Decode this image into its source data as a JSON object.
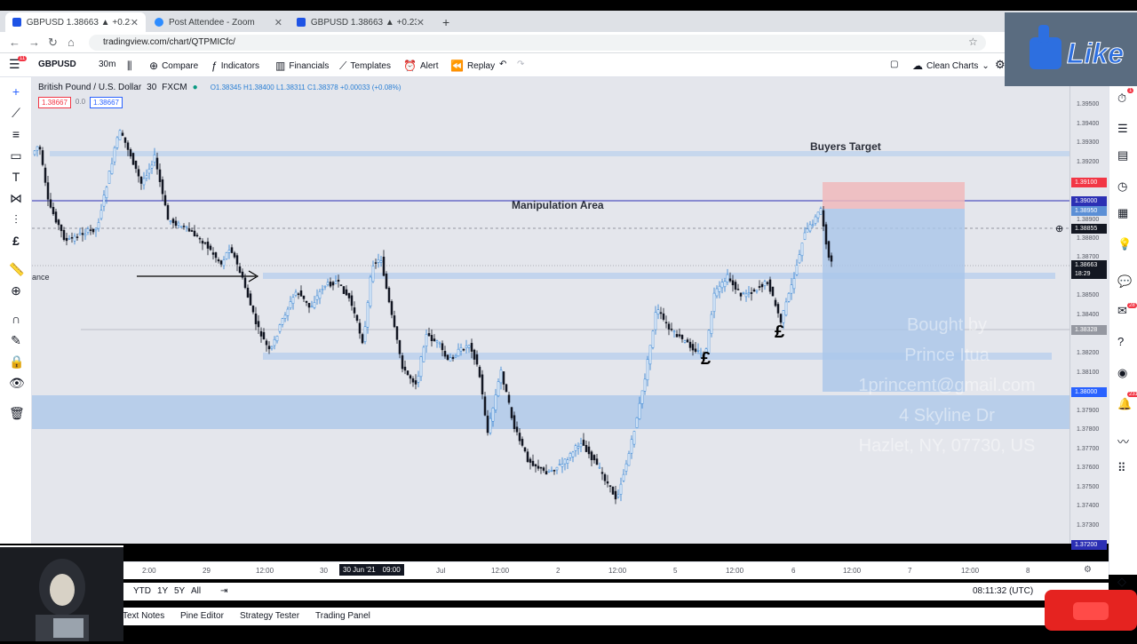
{
  "browser": {
    "tabs": [
      {
        "title": "GBPUSD 1.38663 ▲ +0.23% Cle"
      },
      {
        "title": "Post Attendee - Zoom"
      },
      {
        "title": "GBPUSD 1.38663 ▲ +0.23% nor"
      }
    ],
    "new_tab": "+",
    "url": "tradingview.com/chart/QTPMICfc/"
  },
  "toolbar": {
    "symbol": "GBPUSD",
    "interval": "30m",
    "compare": "Compare",
    "indicators": "Indicators",
    "financials": "Financials",
    "templates": "Templates",
    "alert": "Alert",
    "replay": "Replay",
    "layout": "Clean Charts",
    "menu_badge": "11"
  },
  "legend": {
    "title": "British Pound / U.S. Dollar",
    "interval": "30",
    "source": "FXCM",
    "ohlc": "O1.38345 H1.38400 L1.38311 C1.38378 +0.00033 (+0.08%)",
    "bid": "1.38667",
    "spread": "0.0",
    "ask": "1.38667"
  },
  "annotations": {
    "buyers_target": "Buyers Target",
    "manipulation": "Manipulation Area",
    "resistance": "ance",
    "pound1": "£",
    "pound2": "£",
    "watermark": [
      "Bought by",
      "Prince Itua",
      "1princemt@gmail.com",
      "4 Skyline Dr",
      "Hazlet, NY, 07730, US"
    ]
  },
  "price_scale": {
    "labels": [
      "1.39500",
      "1.39400",
      "1.39300",
      "1.39200",
      "1.38900",
      "1.38800",
      "1.38700",
      "1.38500",
      "1.38400",
      "1.38200",
      "1.38100",
      "1.37900",
      "1.37800",
      "1.37700",
      "1.37600",
      "1.37500",
      "1.37400",
      "1.37300"
    ],
    "badges": {
      "target_top": "1.39100",
      "line_1": "1.39000",
      "line_2": "1.38950",
      "crosshair": "1.38855",
      "current": "1.38663",
      "countdown": "18:29",
      "mid": "1.38328",
      "stop": "1.38000",
      "bottom": "1.37200"
    }
  },
  "time_axis": {
    "labels": [
      "2:00",
      "29",
      "12:00",
      "30",
      "30 Jun '21",
      "09:00",
      "Jul",
      "12:00",
      "2",
      "12:00",
      "5",
      "12:00",
      "6",
      "12:00",
      "7",
      "12:00",
      "8"
    ]
  },
  "bottom": {
    "ranges": [
      "YTD",
      "1Y",
      "5Y",
      "All"
    ],
    "clock": "08:11:32 (UTC)",
    "tabs": [
      "Text Notes",
      "Pine Editor",
      "Strategy Tester",
      "Trading Panel"
    ]
  },
  "overlay": {
    "like": "Like",
    "right_badges": [
      "1",
      "28",
      "231"
    ]
  },
  "colors": {
    "bull": "#2a7fd4",
    "bear": "#131722",
    "zone": "#a9c6ea",
    "target": "#f0b8bc",
    "level_line": "#2b2fb4"
  }
}
